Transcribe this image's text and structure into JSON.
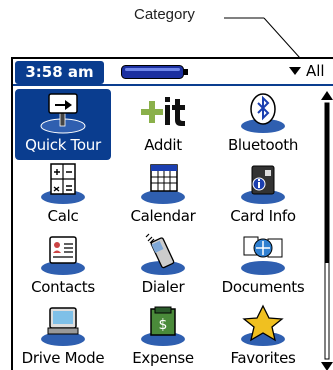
{
  "callout": {
    "label": "Category"
  },
  "statusbar": {
    "time": "3:58 am",
    "category": "All"
  },
  "apps": [
    {
      "label": "Quick Tour",
      "icon": "quick-tour-icon",
      "selected": true
    },
    {
      "label": "Addit",
      "icon": "addit-icon",
      "selected": false
    },
    {
      "label": "Bluetooth",
      "icon": "bluetooth-icon",
      "selected": false
    },
    {
      "label": "Calc",
      "icon": "calculator-icon",
      "selected": false
    },
    {
      "label": "Calendar",
      "icon": "calendar-icon",
      "selected": false
    },
    {
      "label": "Card Info",
      "icon": "card-info-icon",
      "selected": false
    },
    {
      "label": "Contacts",
      "icon": "contacts-icon",
      "selected": false
    },
    {
      "label": "Dialer",
      "icon": "dialer-icon",
      "selected": false
    },
    {
      "label": "Documents",
      "icon": "documents-icon",
      "selected": false
    },
    {
      "label": "Drive Mode",
      "icon": "drive-mode-icon",
      "selected": false
    },
    {
      "label": "Expense",
      "icon": "expense-icon",
      "selected": false
    },
    {
      "label": "Favorites",
      "icon": "favorites-icon",
      "selected": false
    }
  ],
  "colors": {
    "accent": "#0a3d8f",
    "pedestal": "#2f5fb0"
  }
}
